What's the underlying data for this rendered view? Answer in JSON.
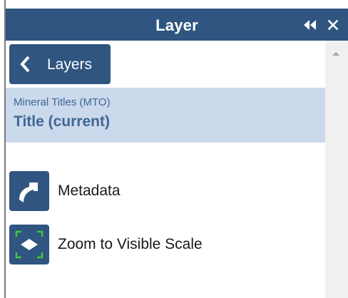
{
  "header": {
    "title": "Layer",
    "collapse_icon": "double-chevron-left-icon",
    "close_icon": "close-icon",
    "background_color": "#2f5580"
  },
  "back_button": {
    "label": "Layers",
    "icon": "chevron-left-icon"
  },
  "layer": {
    "parent": "Mineral Titles (MTO)",
    "name": "Title (current)",
    "highlight_color": "#cad9ec",
    "text_color": "#3f6693"
  },
  "actions": [
    {
      "label": "Metadata",
      "icon": "metadata-arrow-icon"
    },
    {
      "label": "Zoom to Visible Scale",
      "icon": "zoom-scale-icon"
    }
  ],
  "accent_color": "#2f5580",
  "icon_green": "#3fc83a"
}
